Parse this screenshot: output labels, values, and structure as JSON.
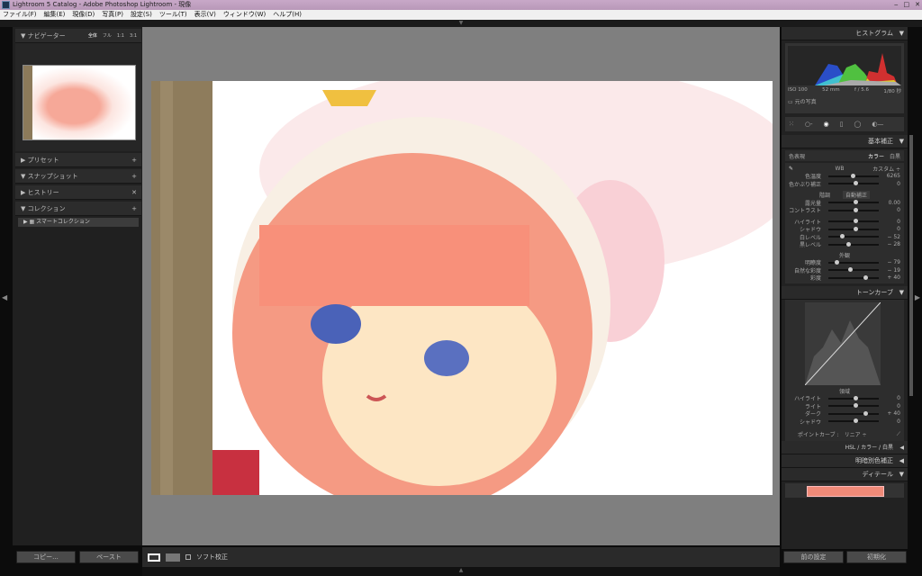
{
  "window": {
    "title": "Lightroom 5 Catalog - Adobe Photoshop Lightroom - 現像",
    "controls": [
      "‒",
      "□",
      "✕"
    ]
  },
  "menu": [
    "ファイル(F)",
    "編集(E)",
    "現像(D)",
    "写真(P)",
    "設定(S)",
    "ツール(T)",
    "表示(V)",
    "ウィンドウ(W)",
    "ヘルプ(H)"
  ],
  "left": {
    "navigator": {
      "label": "ナビゲーター",
      "zoom_opts": [
        "全体",
        "フル",
        "1:1",
        "3:1"
      ]
    },
    "panels": [
      {
        "label": "プリセット",
        "action": "+"
      },
      {
        "label": "スナップショット",
        "action": "+"
      },
      {
        "label": "ヒストリー",
        "action": "✕"
      },
      {
        "label": "コレクション",
        "action": "+"
      }
    ],
    "collection_item": "スマートコレクション",
    "copy": "コピー...",
    "paste": "ペースト"
  },
  "toolbar": {
    "soft_proof": "ソフト校正"
  },
  "right": {
    "histogram": {
      "label": "ヒストグラム",
      "iso": "ISO 100",
      "focal": "52 mm",
      "aperture": "f / 5.6",
      "shutter": "1/80 秒",
      "original": "元の写真"
    },
    "basic": {
      "label": "基本補正",
      "treatment": "色表現",
      "color": "カラー",
      "bw": "白黒",
      "wb_label": "WB",
      "wb_value": "カスタム ÷",
      "wb": [
        {
          "label": "色温度",
          "value": "6265",
          "pos": 0.45
        },
        {
          "label": "色かぶり補正",
          "value": "0",
          "pos": 0.5
        }
      ],
      "tone_label": "階調",
      "auto": "自動補正",
      "tone": [
        {
          "label": "露光量",
          "value": "0.00",
          "pos": 0.5
        },
        {
          "label": "コントラスト",
          "value": "0",
          "pos": 0.5
        }
      ],
      "tone2": [
        {
          "label": "ハイライト",
          "value": "0",
          "pos": 0.5
        },
        {
          "label": "シャドウ",
          "value": "0",
          "pos": 0.5
        },
        {
          "label": "白レベル",
          "value": "− 52",
          "pos": 0.24
        },
        {
          "label": "黒レベル",
          "value": "− 28",
          "pos": 0.36
        }
      ],
      "presence_label": "外観",
      "presence": [
        {
          "label": "明瞭度",
          "value": "− 79",
          "pos": 0.12
        },
        {
          "label": "自然な彩度",
          "value": "− 19",
          "pos": 0.4
        },
        {
          "label": "彩度",
          "value": "+ 40",
          "pos": 0.7
        }
      ]
    },
    "tonecurve": {
      "label": "トーンカーブ",
      "region_label": "領域",
      "regions": [
        {
          "label": "ハイライト",
          "value": "0",
          "pos": 0.5
        },
        {
          "label": "ライト",
          "value": "0",
          "pos": 0.5
        },
        {
          "label": "ダーク",
          "value": "+ 40",
          "pos": 0.7
        },
        {
          "label": "シャドウ",
          "value": "0",
          "pos": 0.5
        }
      ],
      "point_curve": "ポイントカーブ :",
      "point_value": "リニア ÷"
    },
    "hsl": {
      "hsl": "HSL",
      "color": "カラー",
      "bw": "白黒"
    },
    "split": "明暗別色補正",
    "detail": "ディテール",
    "prev": "前の設定",
    "reset": "初期化"
  }
}
